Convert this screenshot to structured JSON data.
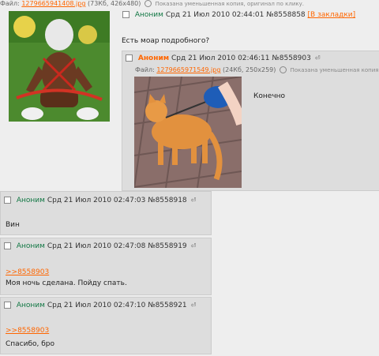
{
  "op": {
    "file_prefix": "Файл:",
    "file_name": "1279665941408.jpg",
    "file_info": "(73Кб, 426x480)",
    "thumb_note": "Показана уменьшенная копия, оригинал по клику.",
    "author": "Аноним",
    "date": "Срд 21 Июл 2010 02:44:01",
    "num": "№8558858",
    "bookmark": "[В закладки]",
    "text": "Есть моар подробного?"
  },
  "posts": [
    {
      "author": "Аноним",
      "date": "Срд 21 Июл 2010 02:46:11",
      "num": "№8558903",
      "file_prefix": "Файл:",
      "file_name": "1279665971549.jpg",
      "file_info": "(24Кб, 250x259)",
      "thumb_note": "Показана уменьшенная копия, ор...",
      "text": "Конечно"
    },
    {
      "author": "Аноним",
      "date": "Срд 21 Июл 2010 02:47:03",
      "num": "№8558918",
      "text": "Вин"
    },
    {
      "author": "Аноним",
      "date": "Срд 21 Июл 2010 02:47:08",
      "num": "№8558919",
      "ref": ">>8558903",
      "text": "Моя ночь сделана. Пойду спать."
    },
    {
      "author": "Аноним",
      "date": "Срд 21 Июл 2010 02:47:10",
      "num": "№8558921",
      "ref": ">>8558903",
      "text": "Спасибо, бро"
    }
  ],
  "colors": {
    "link": "#ff6600",
    "reply_bg": "#dddddd",
    "page_bg": "#eeeeee"
  }
}
